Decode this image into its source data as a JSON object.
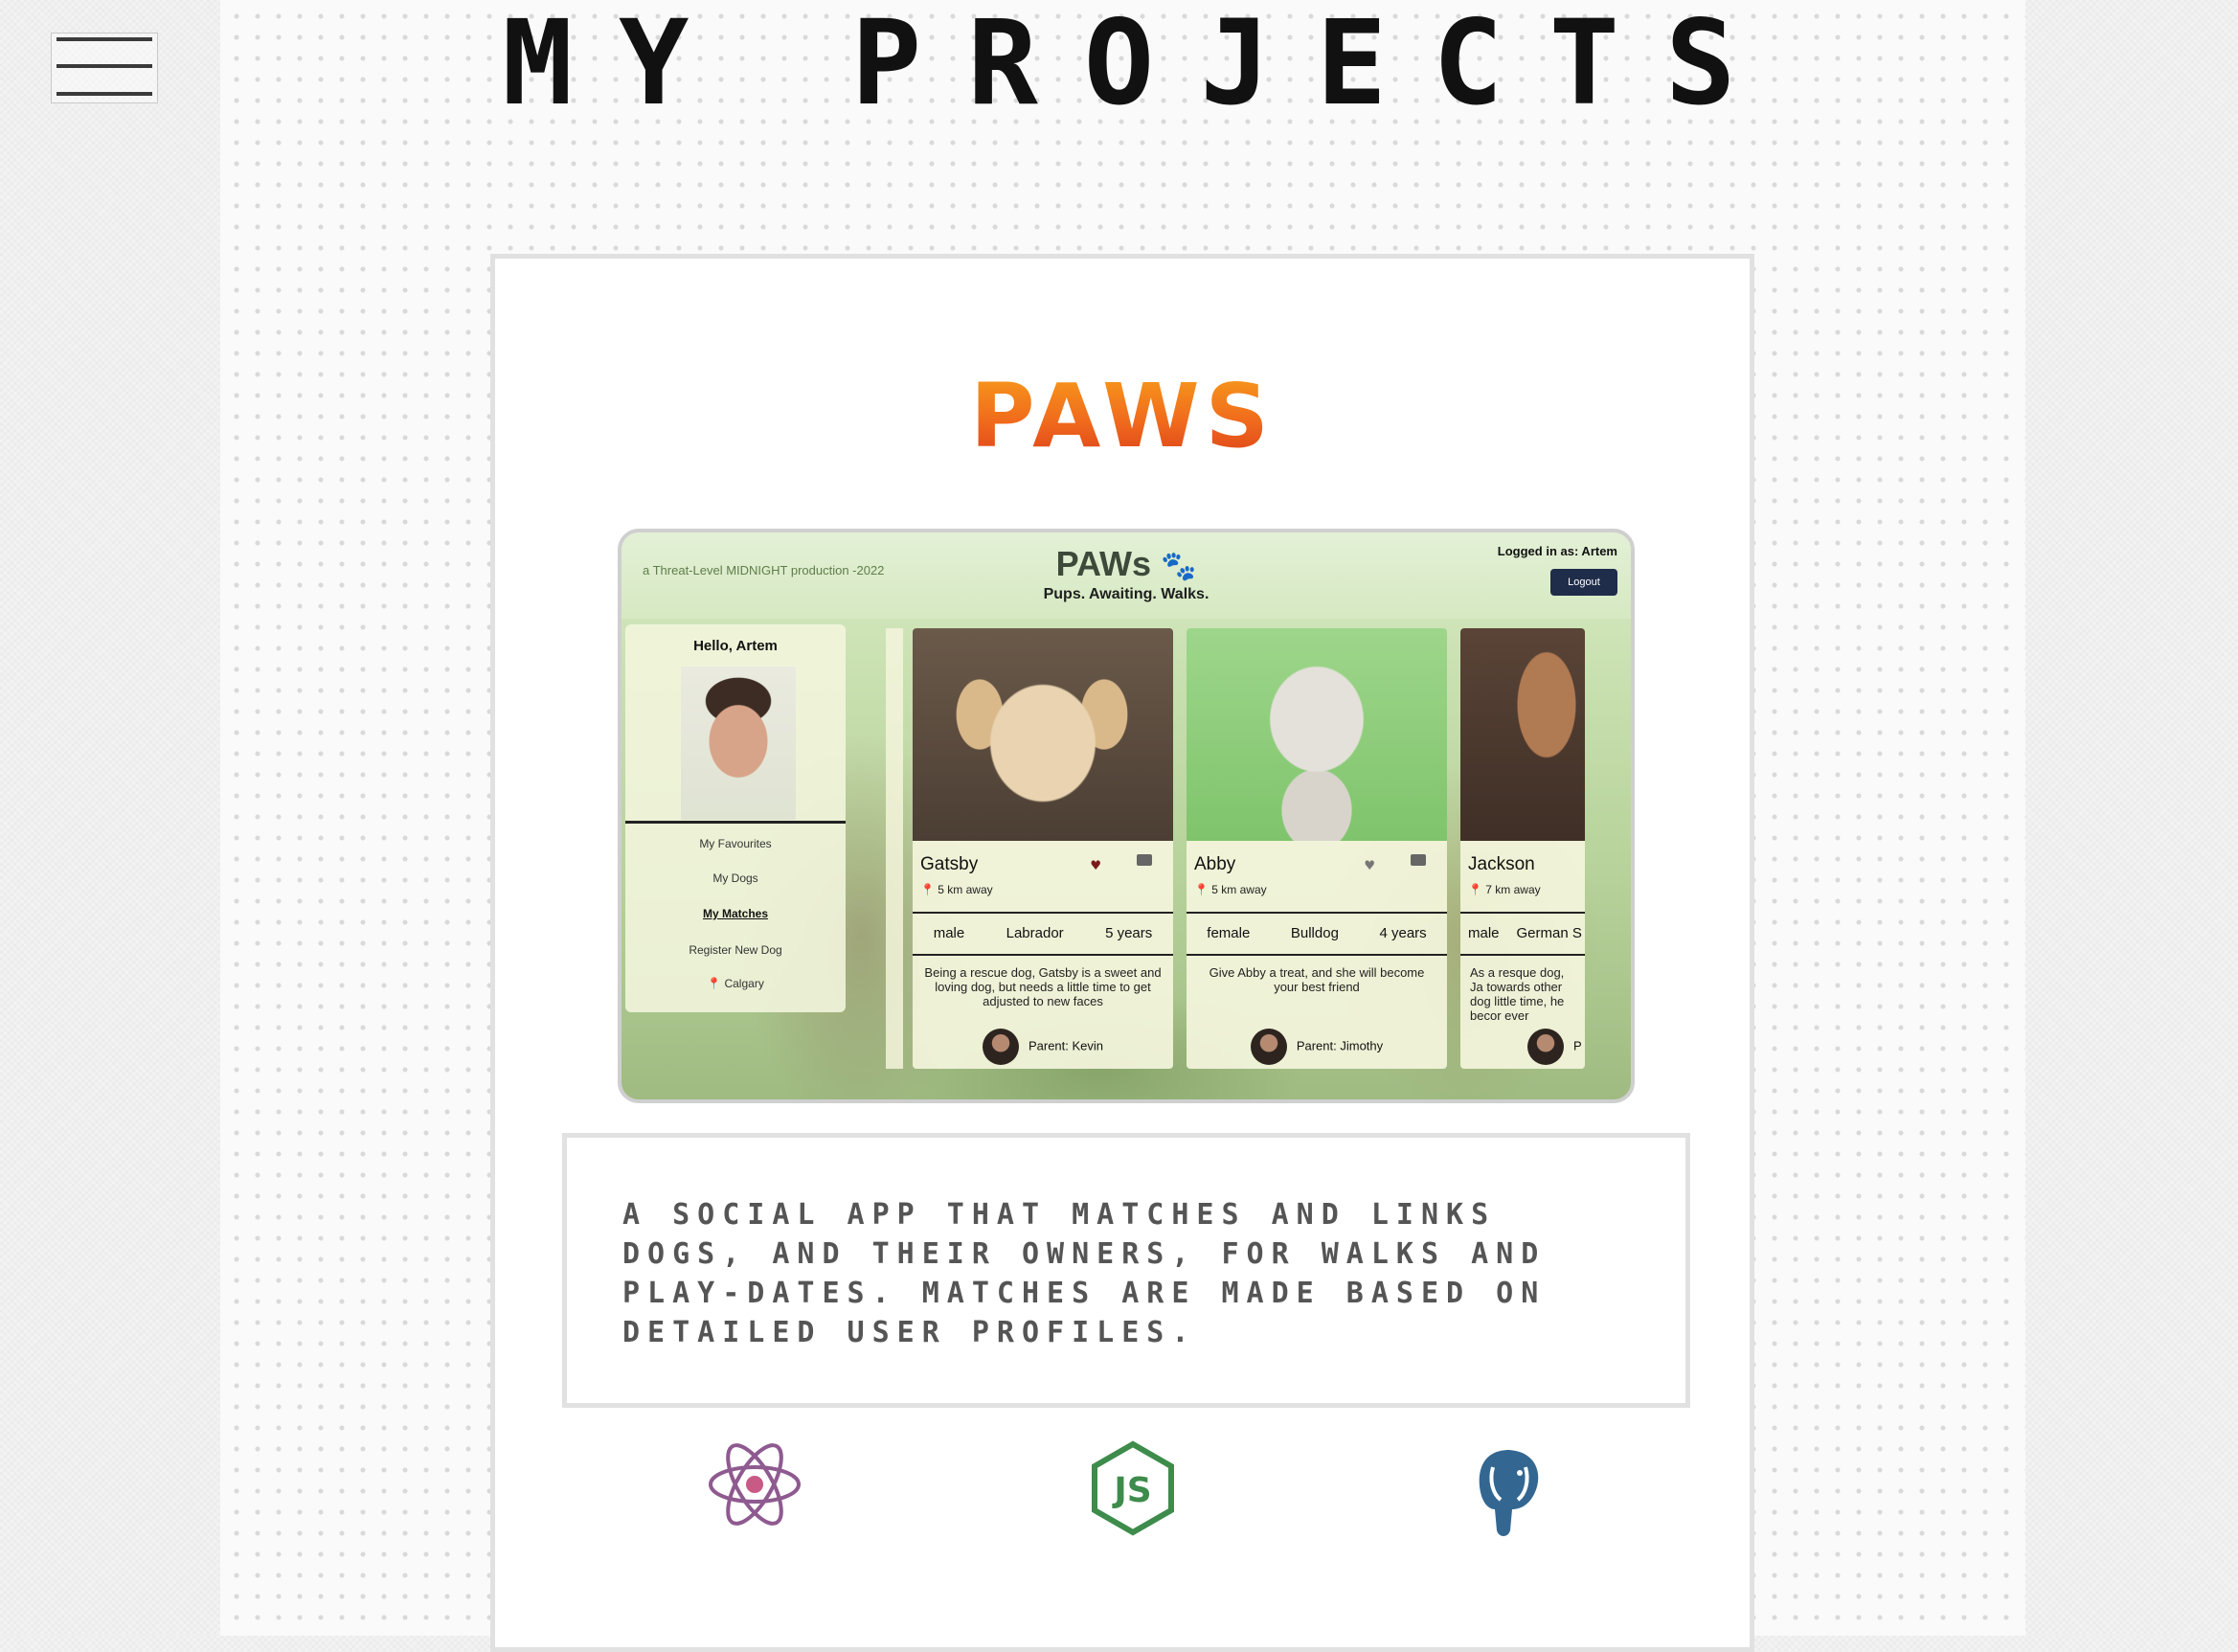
{
  "header": {
    "title": "MY PROJECTS",
    "menu_icon": "hamburger-menu-icon"
  },
  "project": {
    "name": "PAWS",
    "description": "A social app that matches and links dogs, and their owners, for walks and play-dates. Matches are made based on detailed user profiles.",
    "tech_icons": [
      "react-icon",
      "nodejs-icon",
      "postgresql-icon"
    ],
    "name_gradient": [
      "#f8a21b",
      "#d93a1a"
    ],
    "screenshot": {
      "credit": "a Threat-Level MIDNIGHT production -2022",
      "app_title": "PAWs",
      "tagline": "Pups. Awaiting. Walks.",
      "logged_in": "Logged in as: Artem",
      "logout": "Logout",
      "greeting": "Hello, Artem",
      "menu": [
        "My Favourites",
        "My Dogs",
        "My Matches",
        "Register New Dog"
      ],
      "location": "Calgary",
      "dogs": [
        {
          "name": "Gatsby",
          "distance": "5 km away",
          "sex": "male",
          "breed": "Labrador",
          "age": "5 years",
          "bio": "Being a rescue dog, Gatsby is a sweet and loving dog, but needs a little time to get adjusted to new faces",
          "parent": "Parent: Kevin"
        },
        {
          "name": "Abby",
          "distance": "5 km away",
          "sex": "female",
          "breed": "Bulldog",
          "age": "4 years",
          "bio": "Give Abby a treat, and she will become your best friend",
          "parent": "Parent: Jimothy"
        },
        {
          "name": "Jackson",
          "distance": "7 km away",
          "sex": "male",
          "breed": "German S",
          "bio": "As a resque dog, Ja towards other dog little time, he becor ever",
          "parent": "P"
        }
      ]
    }
  }
}
